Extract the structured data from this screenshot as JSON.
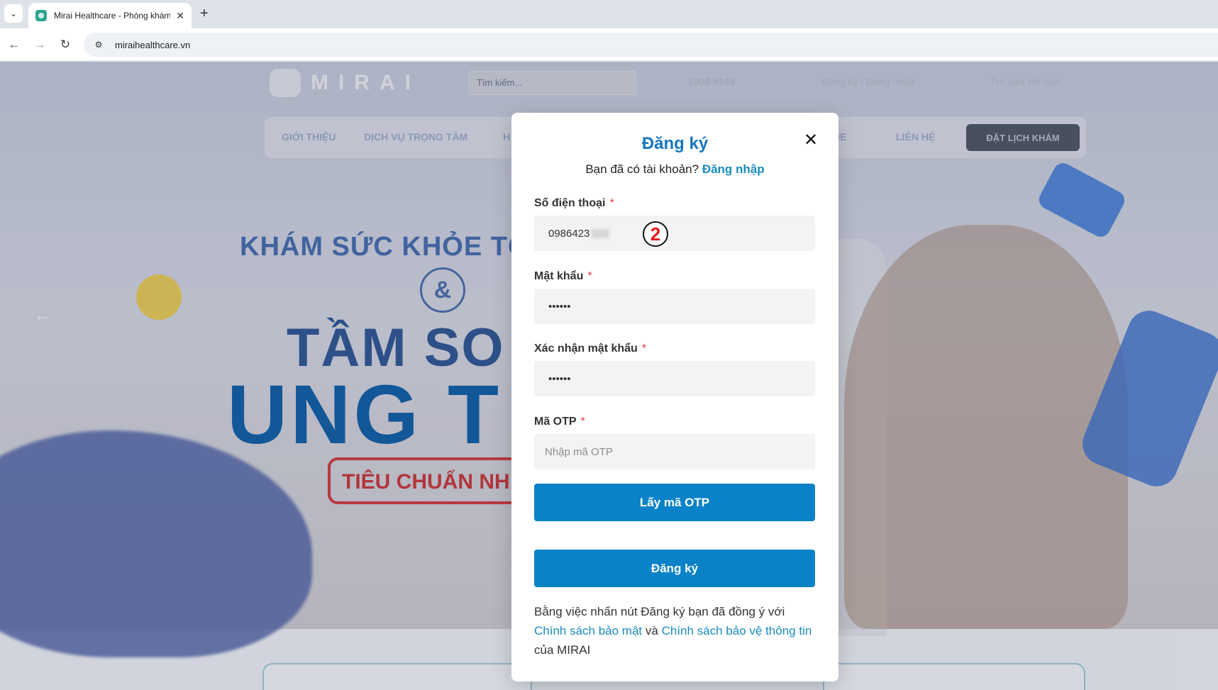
{
  "browser": {
    "tab_title": "Mirai Healthcare - Phòng khám",
    "url": "miraihealthcare.vn"
  },
  "site": {
    "search_placeholder": "Tìm kiếm...",
    "phone": "1900 9185",
    "login_links": "Đăng ký | Đăng nhập",
    "lookup": "Tra cứu kết quả",
    "menu": [
      "GIỚI THIỆU",
      "DỊCH VỤ TRỌNG TÂM",
      "H",
      "KHỎE",
      "LIÊN HỆ"
    ],
    "book_button": "ĐẶT LỊCH KHÁM",
    "hero_line1": "KHÁM SỨC KHỎE TỐ",
    "hero_amp": "&",
    "hero_line2": "TẦM SO",
    "hero_line3": "UNG T",
    "hero_badge": "TIÊU CHUẨN NH"
  },
  "modal": {
    "title": "Đăng ký",
    "subtitle": "Bạn đã có tài khoản?",
    "login_link": "Đăng nhập",
    "phone_label": "Số điện thoại",
    "phone_value": "0986423",
    "step_marker": "2",
    "password_label": "Mật khẩu",
    "password_value": "••••••",
    "confirm_label": "Xác nhận mật khẩu",
    "confirm_value": "••••••",
    "otp_label": "Mã OTP",
    "otp_placeholder": "Nhập mã OTP",
    "get_otp_button": "Lấy mã OTP",
    "register_button": "Đăng ký",
    "terms_prefix": "Bằng việc nhấn nút Đăng ký bạn đã đồng ý với",
    "privacy_link": "Chính sách bảo mật",
    "and": "và",
    "protection_link": "Chính sách bảo vệ thông tin",
    "terms_suffix": "của MIRAI",
    "required_mark": "*"
  }
}
